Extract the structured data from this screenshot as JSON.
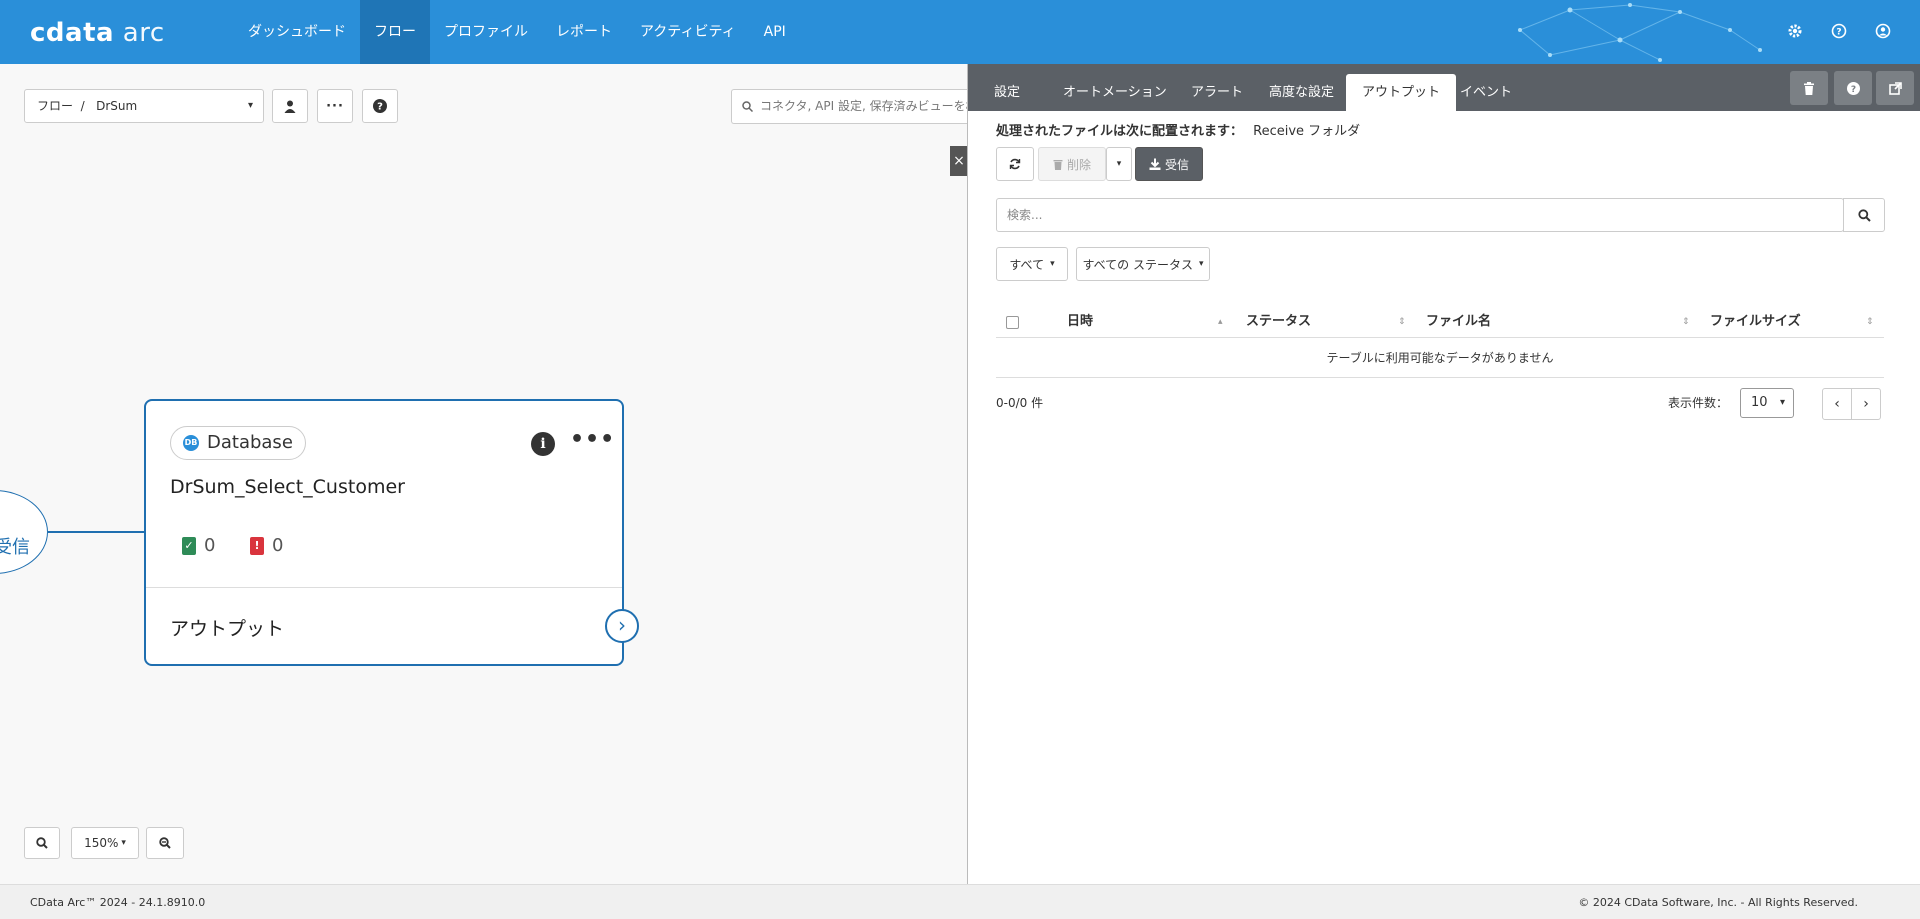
{
  "app": {
    "logo_bold": "cdata",
    "logo_light": " arc",
    "nav": [
      "ダッシュボード",
      "フロー",
      "プロファイル",
      "レポート",
      "アクティビティ",
      "API"
    ],
    "active_nav_index": 1,
    "icons": [
      "gear-icon",
      "help-icon",
      "user-icon"
    ]
  },
  "canvas": {
    "breadcrumb": "フロー  /   DrSum",
    "search_placeholder": "コネクタ, API 設定, 保存済みビューを検索",
    "close_label": "×",
    "receive_node_label": "受信",
    "node": {
      "type_label": "Database",
      "name": "DrSum_Select_Customer",
      "success_count": "0",
      "error_count": "0",
      "output_label": "アウトプット"
    },
    "zoom_level": "150%"
  },
  "panel": {
    "tabs": [
      "設定",
      "オートメーション",
      "アラート",
      "高度な設定",
      "アウトプット",
      "イベント"
    ],
    "active_tab_index": 4,
    "processed_label": "処理されたファイルは次に配置されます：",
    "processed_value": "Receive フォルダ",
    "delete_label": "削除",
    "receive_label": "受信",
    "search_placeholder": "検索...",
    "filter_all": "すべて",
    "filter_status": "すべての ステータス",
    "columns": [
      "日時",
      "ステータス",
      "ファイル名",
      "ファイルサイズ"
    ],
    "empty_message": "テーブルに利用可能なデータがありません",
    "record_count": "0-0/0 件",
    "per_page_label": "表示件数：",
    "per_page_value": "10"
  },
  "footer": {
    "version": "CData Arc™ 2024 - 24.1.8910.0",
    "copyright": "© 2024 CData Software, Inc. - All Rights Reserved."
  },
  "colors": {
    "header": "#2a8fd9",
    "accent": "#1f6fb0",
    "panel_tabs": "#5b6066",
    "success": "#2e8b57",
    "error": "#d9343d"
  }
}
